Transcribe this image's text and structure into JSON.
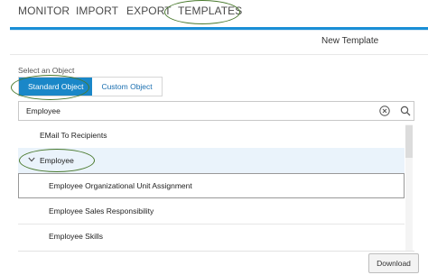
{
  "tabs": [
    {
      "label": "MONITOR"
    },
    {
      "label": "IMPORT"
    },
    {
      "label": "EXPORT"
    },
    {
      "label": "TEMPLATES",
      "active": true
    }
  ],
  "panel": {
    "title": "New Template"
  },
  "object_selector": {
    "label": "Select an Object",
    "options": [
      "Standard Object",
      "Custom Object"
    ],
    "selected": "Standard Object"
  },
  "search": {
    "value": "Employee",
    "clear_icon": "close-circle-icon",
    "search_icon": "search-icon"
  },
  "list": {
    "items": [
      {
        "label": "EMail To Recipients"
      },
      {
        "label": "Employee",
        "expanded": true
      },
      {
        "label": "Employee Organizational Unit Assignment",
        "selected": true
      },
      {
        "label": "Employee Sales Responsibility"
      },
      {
        "label": "Employee Skills"
      }
    ]
  },
  "footer": {
    "download_label": "Download"
  },
  "colors": {
    "accent": "#1a87c8",
    "annotation": "#4a7a2e",
    "row_highlight": "#eaf3fb"
  }
}
